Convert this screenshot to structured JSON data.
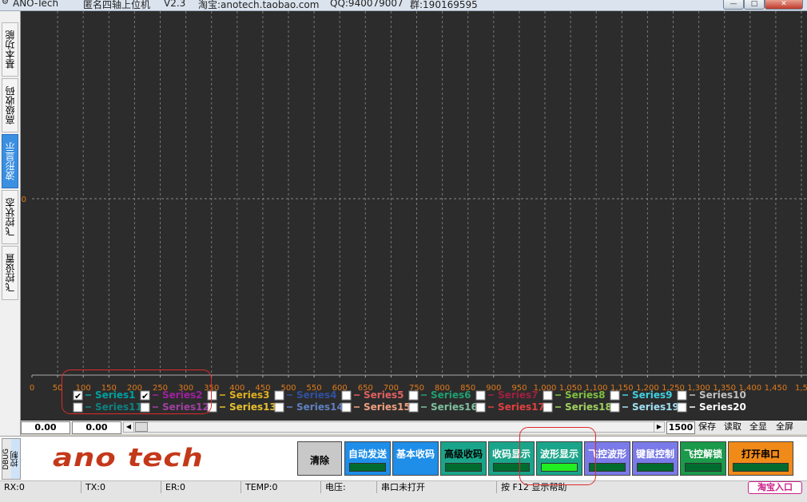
{
  "titlebar": {
    "app": "ANO-Tech",
    "name": "匿名四轴上位机",
    "version": "V2.3",
    "shop": "淘宝:anotech.taobao.com",
    "qq": "QQ:940079007",
    "group": "群:190169595",
    "min": "—",
    "max": "□",
    "close": "✕"
  },
  "sidetabs": [
    {
      "label": "基本功能",
      "active": false
    },
    {
      "label": "高级收码",
      "active": false
    },
    {
      "label": "波形显示",
      "active": true
    },
    {
      "label": "飞控状态",
      "active": false
    },
    {
      "label": "飞控设置",
      "active": false
    }
  ],
  "chart_data": {
    "type": "line",
    "y_tick_labels": [
      "0"
    ],
    "x_tick_labels": [
      "0",
      "50",
      "100",
      "150",
      "200",
      "250",
      "300",
      "350",
      "400",
      "450",
      "500",
      "550",
      "600",
      "650",
      "700",
      "750",
      "800",
      "850",
      "900",
      "950",
      "1,000",
      "1,050",
      "1,100",
      "1,150",
      "1,200",
      "1,250",
      "1,300",
      "1,350",
      "1,400",
      "1,450",
      "1,5"
    ],
    "grid": true,
    "series": []
  },
  "legend": [
    {
      "label": "Series1",
      "checked": true,
      "color": "#00a0a0"
    },
    {
      "label": "Series2",
      "checked": true,
      "color": "#a020a0"
    },
    {
      "label": "Series3",
      "checked": false,
      "color": "#e0b020"
    },
    {
      "label": "Series4",
      "checked": false,
      "color": "#3050a0"
    },
    {
      "label": "Series5",
      "checked": false,
      "color": "#e06060"
    },
    {
      "label": "Series6",
      "checked": false,
      "color": "#20a070"
    },
    {
      "label": "Series7",
      "checked": false,
      "color": "#a02040"
    },
    {
      "label": "Series8",
      "checked": false,
      "color": "#80c040"
    },
    {
      "label": "Series9",
      "checked": false,
      "color": "#40d0e0"
    },
    {
      "label": "Series10",
      "checked": false,
      "color": "#c0c0c0"
    },
    {
      "label": "Series11",
      "checked": false,
      "color": "#108080"
    },
    {
      "label": "Series12",
      "checked": false,
      "color": "#a040a0"
    },
    {
      "label": "Series13",
      "checked": false,
      "color": "#e8c030"
    },
    {
      "label": "Series14",
      "checked": false,
      "color": "#6080c0"
    },
    {
      "label": "Series15",
      "checked": false,
      "color": "#f0a080"
    },
    {
      "label": "Series16",
      "checked": false,
      "color": "#80c0a0"
    },
    {
      "label": "Series17",
      "checked": false,
      "color": "#e04040"
    },
    {
      "label": "Series18",
      "checked": false,
      "color": "#a0d060"
    },
    {
      "label": "Series19",
      "checked": false,
      "color": "#a0e0f0"
    },
    {
      "label": "Series20",
      "checked": false,
      "color": "#ffffff"
    }
  ],
  "scrollrow": {
    "val1": "0.00",
    "val2": "0.00",
    "points": "1500",
    "save": "保存",
    "read": "读取",
    "showall": "全显",
    "fullscreen": "全屏"
  },
  "bottom": {
    "dbug": "DBUG",
    "ctrl": "控制",
    "logo": "ano tech",
    "buttons": [
      {
        "label": "清除",
        "bg": "#c8c8c8",
        "fg": "#000000",
        "ind": ""
      },
      {
        "label": "自动发送",
        "bg": "#1e8ee8",
        "fg": "#ffffff",
        "ind": "#006b2e"
      },
      {
        "label": "基本收码",
        "bg": "#1e8ee8",
        "fg": "#ffffff",
        "ind": ""
      },
      {
        "label": "高级收码",
        "bg": "#1aa58a",
        "fg": "#000000",
        "ind": "#006b2e"
      },
      {
        "label": "收码显示",
        "bg": "#1aa58a",
        "fg": "#ffffff",
        "ind": "#006b2e"
      },
      {
        "label": "波形显示",
        "bg": "#1aa58a",
        "fg": "#ffffff",
        "ind": "#21ee21"
      },
      {
        "label": "飞控波形",
        "bg": "#7a7ae8",
        "fg": "#ffffff",
        "ind": "#006b2e"
      },
      {
        "label": "键鼠控制",
        "bg": "#7a7ae8",
        "fg": "#ffffff",
        "ind": "#006b2e"
      },
      {
        "label": "飞控解锁",
        "bg": "#1a9a4a",
        "fg": "#ffffff",
        "ind": "#006b2e"
      },
      {
        "label": "打开串口",
        "bg": "#f08a18",
        "fg": "#000000",
        "ind": "#006b2e"
      }
    ]
  },
  "status": {
    "rx": "RX:0",
    "tx": "TX:0",
    "er": "ER:0",
    "temp": "TEMP:0",
    "voltage": "电压:",
    "port": "串口未打开",
    "help": "按 F12 显示帮助",
    "taobao": "淘宝入口"
  }
}
